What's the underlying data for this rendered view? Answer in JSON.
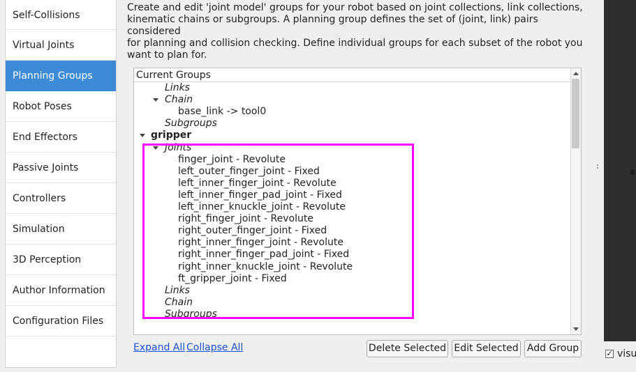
{
  "nav": {
    "items": [
      {
        "label": "Self-Collisions",
        "active": false
      },
      {
        "label": "Virtual Joints",
        "active": false
      },
      {
        "label": "Planning Groups",
        "active": true
      },
      {
        "label": "Robot Poses",
        "active": false
      },
      {
        "label": "End Effectors",
        "active": false
      },
      {
        "label": "Passive Joints",
        "active": false
      },
      {
        "label": "Controllers",
        "active": false
      },
      {
        "label": "Simulation",
        "active": false
      },
      {
        "label": "3D Perception",
        "active": false
      },
      {
        "label": "Author Information",
        "active": false
      },
      {
        "label": "Configuration Files",
        "active": false
      }
    ]
  },
  "description": {
    "lines": [
      "Create and edit 'joint model' groups for your robot based on joint collections, link collections,",
      "kinematic chains or subgroups. A planning group defines the set of (joint, link) pairs considered",
      "for planning and collision checking. Define individual groups for each subset of the robot you",
      "want to plan for."
    ]
  },
  "tree": {
    "header": "Current Groups",
    "rows": [
      {
        "text": "Links",
        "style": "italic",
        "level": 2,
        "expander": false
      },
      {
        "text": "Chain",
        "style": "italic",
        "level": 2,
        "expander": true
      },
      {
        "text": "base_link  ->  tool0",
        "style": "normal",
        "level": 3,
        "expander": false
      },
      {
        "text": "Subgroups",
        "style": "italic",
        "level": 2,
        "expander": false
      },
      {
        "text": "gripper",
        "style": "bold",
        "level": 1,
        "expander": true
      },
      {
        "text": "Joints",
        "style": "italic",
        "level": 2,
        "expander": true
      },
      {
        "text": "finger_joint - Revolute",
        "style": "normal",
        "level": 3,
        "expander": false
      },
      {
        "text": "left_outer_finger_joint - Fixed",
        "style": "normal",
        "level": 3,
        "expander": false
      },
      {
        "text": "left_inner_finger_joint - Revolute",
        "style": "normal",
        "level": 3,
        "expander": false
      },
      {
        "text": "left_inner_finger_pad_joint - Fixed",
        "style": "normal",
        "level": 3,
        "expander": false
      },
      {
        "text": "left_inner_knuckle_joint - Revolute",
        "style": "normal",
        "level": 3,
        "expander": false
      },
      {
        "text": "right_finger_joint - Revolute",
        "style": "normal",
        "level": 3,
        "expander": false
      },
      {
        "text": "right_outer_finger_joint - Fixed",
        "style": "normal",
        "level": 3,
        "expander": false
      },
      {
        "text": "right_inner_finger_joint - Revolute",
        "style": "normal",
        "level": 3,
        "expander": false
      },
      {
        "text": "right_inner_finger_pad_joint - Fixed",
        "style": "normal",
        "level": 3,
        "expander": false
      },
      {
        "text": "right_inner_knuckle_joint - Revolute",
        "style": "normal",
        "level": 3,
        "expander": false
      },
      {
        "text": "ft_gripper_joint - Fixed",
        "style": "normal",
        "level": 3,
        "expander": false
      },
      {
        "text": "Links",
        "style": "italic",
        "level": 2,
        "expander": false
      },
      {
        "text": "Chain",
        "style": "italic",
        "level": 2,
        "expander": false
      },
      {
        "text": "Subgroups",
        "style": "italic",
        "level": 2,
        "expander": false
      }
    ]
  },
  "actions": {
    "expand_all": "Expand All",
    "collapse_all": "Collapse All",
    "delete_selected": "Delete Selected",
    "edit_selected": "Edit Selected",
    "add_group": "Add Group"
  },
  "right_panel": {
    "checkbox_label": "visu",
    "checked": true
  },
  "colors": {
    "accent": "#3d8bd6",
    "highlight": "#ff00ff",
    "link": "#1a4fd6"
  }
}
